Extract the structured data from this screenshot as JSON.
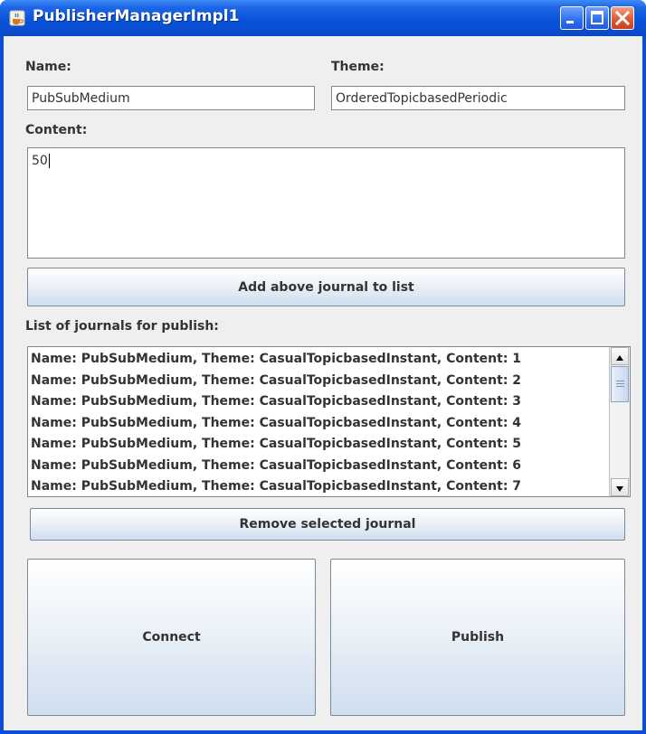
{
  "window": {
    "title": "PublisherManagerImpl1"
  },
  "form": {
    "name_label": "Name:",
    "name_value": "PubSubMedium",
    "theme_label": "Theme:",
    "theme_value": "OrderedTopicbasedPeriodic",
    "content_label": "Content:",
    "content_value": "50"
  },
  "buttons": {
    "add": "Add above journal to list",
    "remove": "Remove selected journal",
    "connect": "Connect",
    "publish": "Publish"
  },
  "journal_list": {
    "label": "List of journals for publish:",
    "items": [
      "Name: PubSubMedium, Theme: CasualTopicbasedInstant, Content: 1",
      "Name: PubSubMedium, Theme: CasualTopicbasedInstant, Content: 2",
      "Name: PubSubMedium, Theme: CasualTopicbasedInstant, Content: 3",
      "Name: PubSubMedium, Theme: CasualTopicbasedInstant, Content: 4",
      "Name: PubSubMedium, Theme: CasualTopicbasedInstant, Content: 5",
      "Name: PubSubMedium, Theme: CasualTopicbasedInstant, Content: 6",
      "Name: PubSubMedium, Theme: CasualTopicbasedInstant, Content: 7"
    ]
  },
  "colors": {
    "titlebar": "#0754da",
    "client_bg": "#efefef",
    "close_button": "#e2582f"
  },
  "icons": {
    "app": "java-cup-icon",
    "minimize": "minimize-icon",
    "maximize": "maximize-icon",
    "close": "close-icon"
  }
}
